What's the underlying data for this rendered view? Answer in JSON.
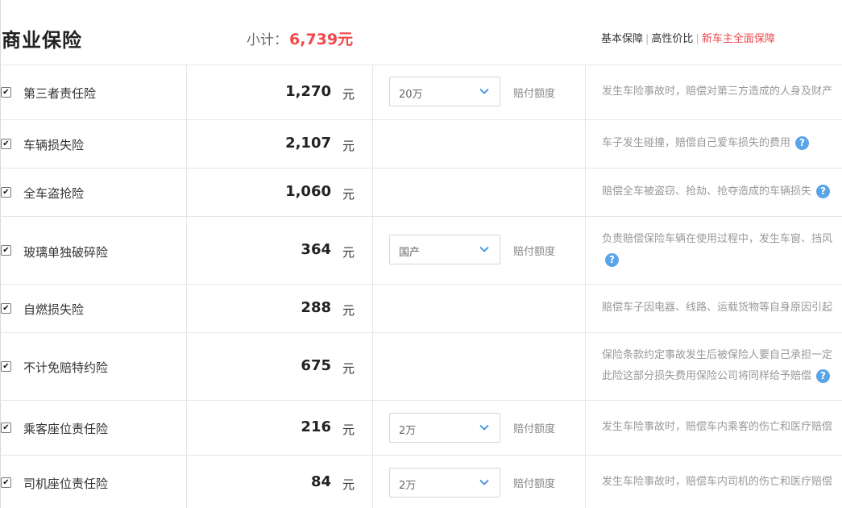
{
  "header": {
    "title": "商业保险",
    "subtotal_label": "小计：",
    "subtotal_amount": "6,739元",
    "plans": [
      "基本保障",
      "高性价比",
      "新车主全面保障"
    ]
  },
  "unit": "元",
  "coverage_label": "赔付额度",
  "help_glyph": "?",
  "check_glyph": "✔",
  "rows": [
    {
      "name": "第三者责任险",
      "price": "1,270",
      "select": "20万",
      "desc1": "发生车险事故时，赔偿对第三方造成的人身及财产"
    },
    {
      "name": "车辆损失险",
      "price": "2,107",
      "desc1": "车子发生碰撞，赔偿自己爱车损失的费用"
    },
    {
      "name": "全车盗抢险",
      "price": "1,060",
      "desc1": "赔偿全车被盗窃、抢劫、抢夺造成的车辆损失"
    },
    {
      "name": "玻璃单独破碎险",
      "price": "364",
      "select": "国产",
      "desc1": "负责赔偿保险车辆在使用过程中，发生车窗、挡风"
    },
    {
      "name": "自燃损失险",
      "price": "288",
      "desc1": "赔偿车子因电器、线路、运载货物等自身原因引起"
    },
    {
      "name": "不计免赔特约险",
      "price": "675",
      "desc1": "保险条款约定事故发生后被保险人要自己承担一定",
      "desc2": "此险这部分损失费用保险公司将同样给予赔偿"
    },
    {
      "name": "乘客座位责任险",
      "price": "216",
      "select": "2万",
      "desc1": "发生车险事故时，赔偿车内乘客的伤亡和医疗赔偿"
    },
    {
      "name": "司机座位责任险",
      "price": "84",
      "select": "2万",
      "desc1": "发生车险事故时，赔偿车内司机的伤亡和医疗赔偿"
    }
  ]
}
